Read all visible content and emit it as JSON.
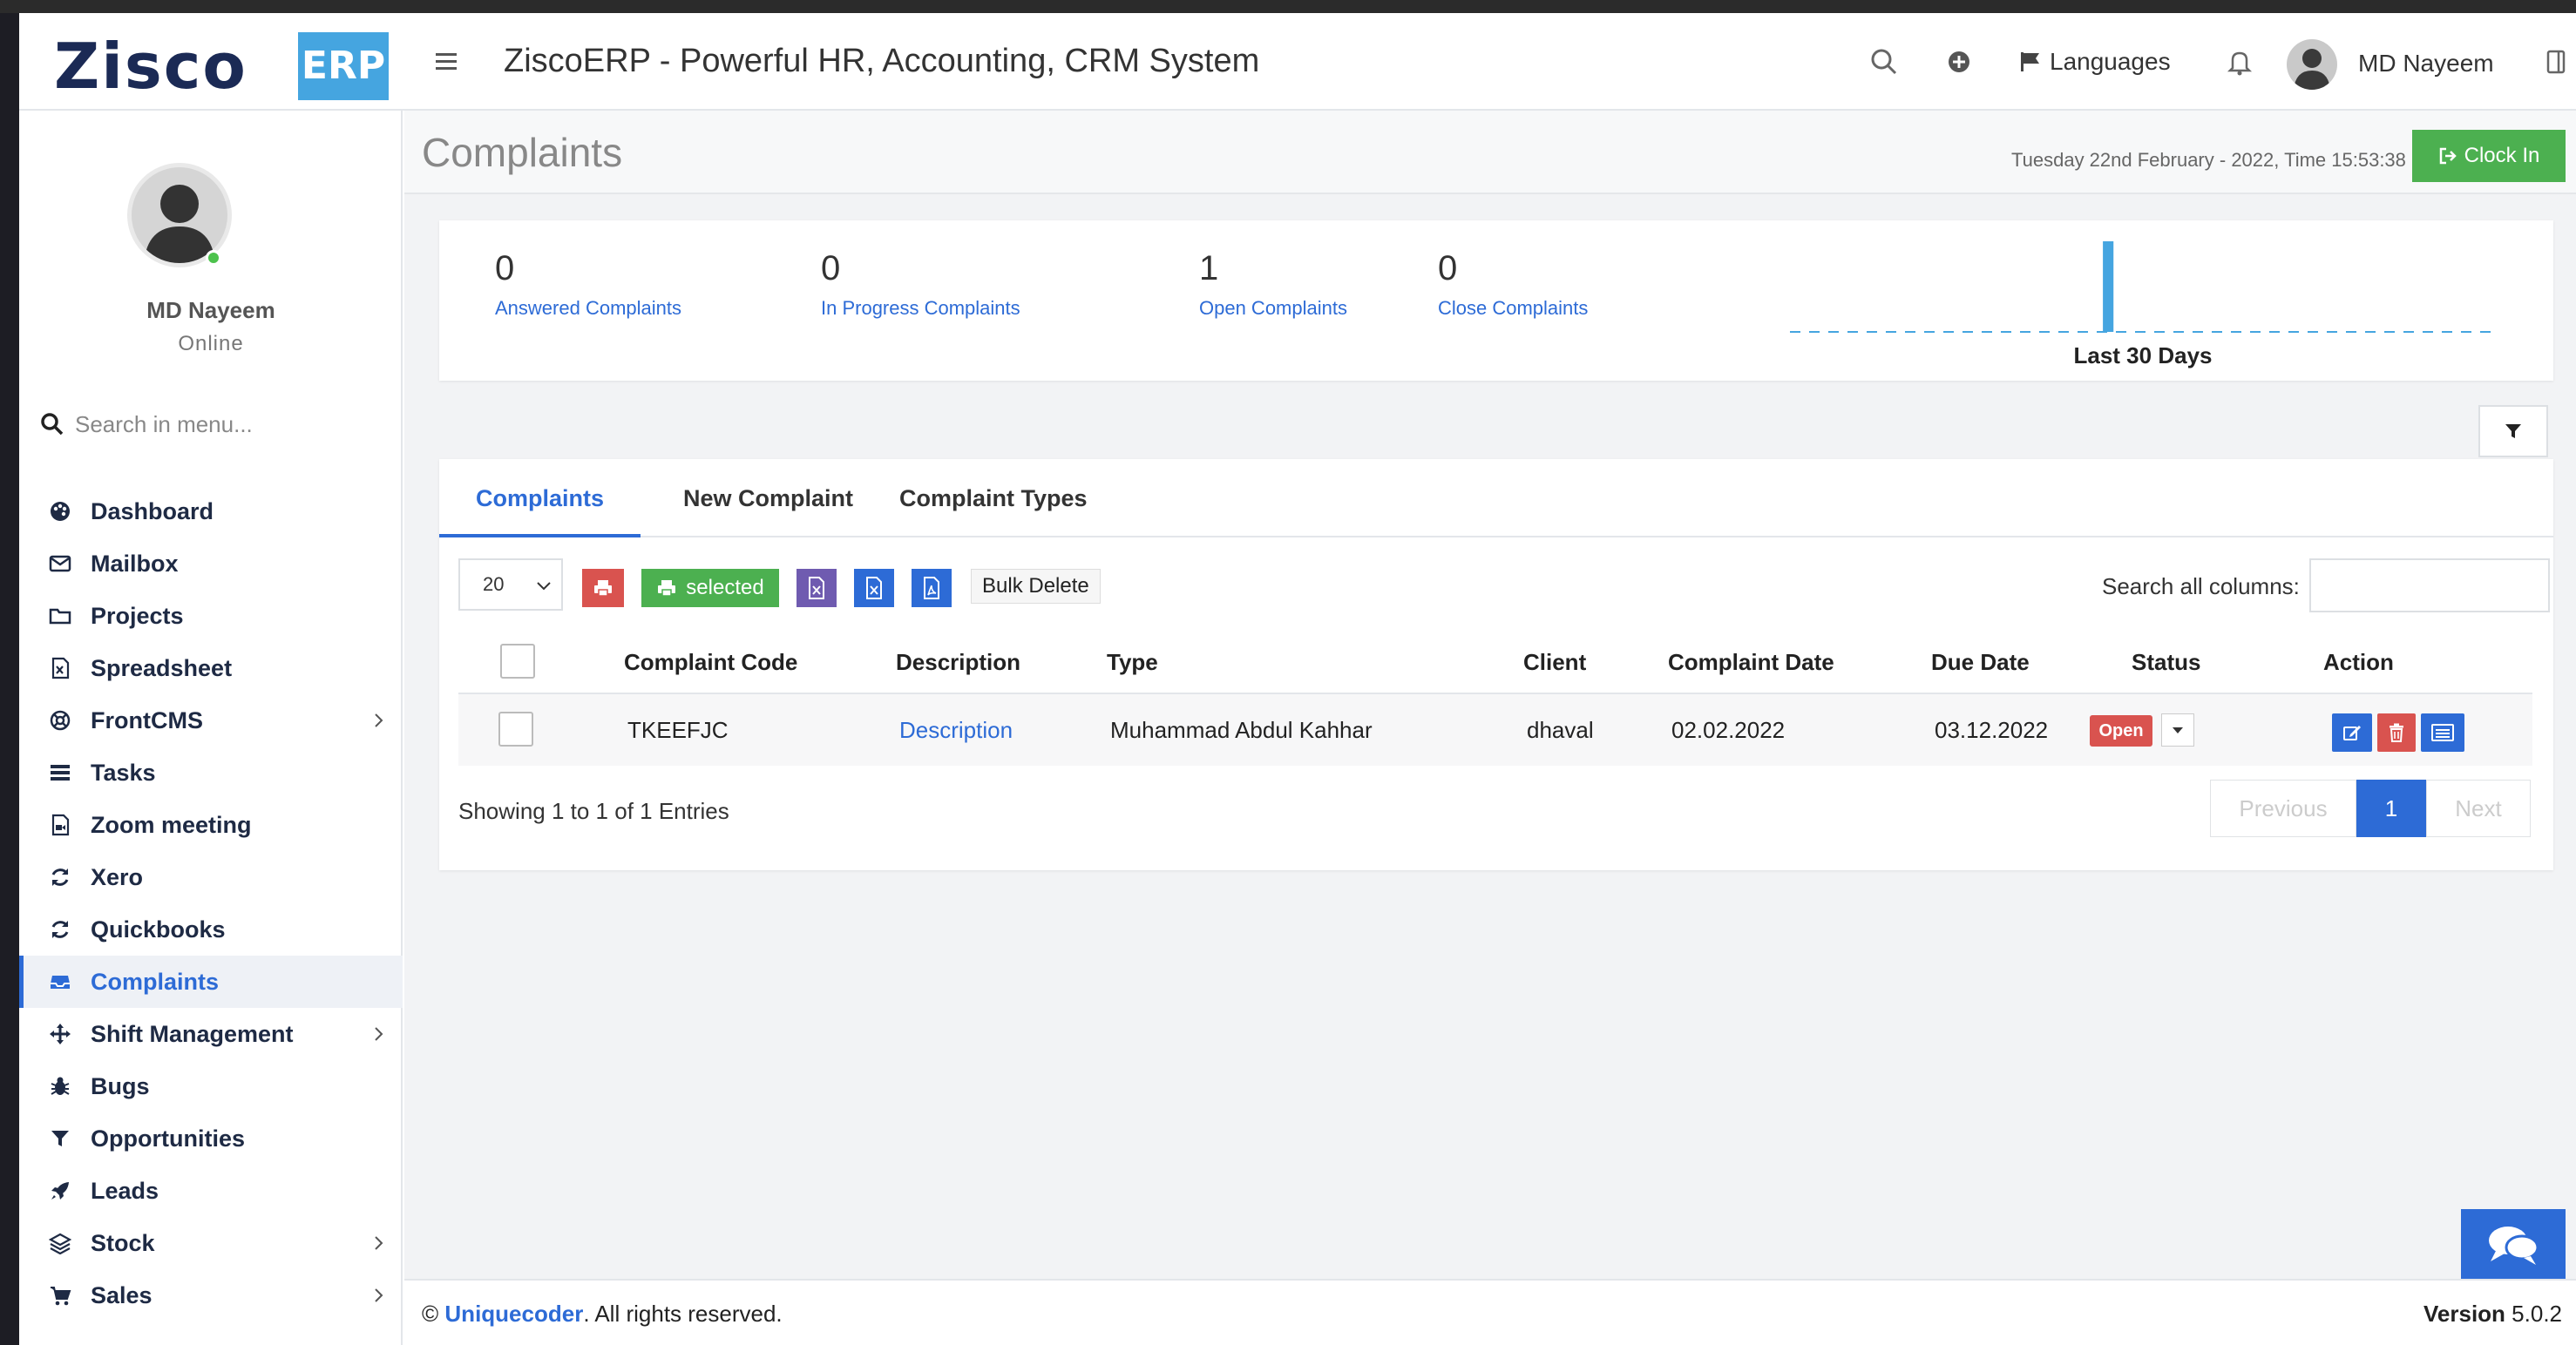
{
  "header": {
    "logo_text": "Zisco",
    "logo_badge": "ERP",
    "title": "ZiscoERP - Powerful HR, Accounting, CRM System",
    "languages_label": "Languages",
    "user_name": "MD Nayeem"
  },
  "sidebar": {
    "user_name": "MD Nayeem",
    "user_status": "Online",
    "search_placeholder": "Search in menu...",
    "items": [
      {
        "label": "Dashboard",
        "icon": "palette-icon",
        "has_submenu": false
      },
      {
        "label": "Mailbox",
        "icon": "envelope-icon",
        "has_submenu": false
      },
      {
        "label": "Projects",
        "icon": "folder-icon",
        "has_submenu": false
      },
      {
        "label": "Spreadsheet",
        "icon": "file-excel-icon",
        "has_submenu": false
      },
      {
        "label": "FrontCMS",
        "icon": "life-ring-icon",
        "has_submenu": true
      },
      {
        "label": "Tasks",
        "icon": "tasks-icon",
        "has_submenu": false
      },
      {
        "label": "Zoom meeting",
        "icon": "video-file-icon",
        "has_submenu": false
      },
      {
        "label": "Xero",
        "icon": "refresh-icon",
        "has_submenu": false
      },
      {
        "label": "Quickbooks",
        "icon": "refresh-icon",
        "has_submenu": false
      },
      {
        "label": "Complaints",
        "icon": "inbox-icon",
        "has_submenu": false,
        "active": true
      },
      {
        "label": "Shift Management",
        "icon": "arrows-icon",
        "has_submenu": true
      },
      {
        "label": "Bugs",
        "icon": "bug-icon",
        "has_submenu": false
      },
      {
        "label": "Opportunities",
        "icon": "filter-icon",
        "has_submenu": false
      },
      {
        "label": "Leads",
        "icon": "rocket-icon",
        "has_submenu": false
      },
      {
        "label": "Stock",
        "icon": "layers-icon",
        "has_submenu": true
      },
      {
        "label": "Sales",
        "icon": "cart-icon",
        "has_submenu": true
      }
    ]
  },
  "page": {
    "title": "Complaints",
    "datetime": "Tuesday 22nd February - 2022,  Time  15:53:38",
    "clock_in_label": "Clock In"
  },
  "stats": [
    {
      "value": "0",
      "label": "Answered Complaints"
    },
    {
      "value": "0",
      "label": "In Progress Complaints"
    },
    {
      "value": "1",
      "label": "Open Complaints"
    },
    {
      "value": "0",
      "label": "Close Complaints"
    }
  ],
  "sparkline": {
    "label": "Last 30 Days",
    "values": [
      0,
      0,
      0,
      0,
      0,
      0,
      0,
      0,
      0,
      0,
      0,
      0,
      0,
      1,
      0,
      0,
      0,
      0,
      0,
      0,
      0,
      0,
      0,
      0,
      0,
      0,
      0,
      0,
      0,
      0
    ],
    "color": "#45a5e0"
  },
  "tabs": [
    {
      "label": "Complaints",
      "active": true
    },
    {
      "label": "New Complaint",
      "active": false
    },
    {
      "label": "Complaint Types",
      "active": false
    }
  ],
  "toolbar": {
    "page_size": "20",
    "selected_label": "selected",
    "bulk_delete_label": "Bulk Delete",
    "search_label": "Search all columns:"
  },
  "table": {
    "columns": [
      "Complaint Code",
      "Description",
      "Type",
      "Client",
      "Complaint Date",
      "Due Date",
      "Status",
      "Action"
    ],
    "rows": [
      {
        "code": "TKEEFJC",
        "description": "Description",
        "type": "Muhammad Abdul Kahhar",
        "client": "dhaval",
        "complaint_date": "02.02.2022",
        "due_date": "03.12.2022",
        "status": "Open"
      }
    ]
  },
  "pagination": {
    "showing": "Showing 1 to 1 of 1 Entries",
    "previous": "Previous",
    "current": "1",
    "next": "Next"
  },
  "footer": {
    "copyright_symbol": "©",
    "company": "Uniquecoder",
    "rights": ". All rights reserved.",
    "version_label": "Version",
    "version": "5.0.2"
  },
  "colors": {
    "accent": "#2d6bd6",
    "success": "#4cb050",
    "danger": "#d9534f",
    "purple": "#6f5bb0",
    "brand_light": "#45a5e0"
  }
}
